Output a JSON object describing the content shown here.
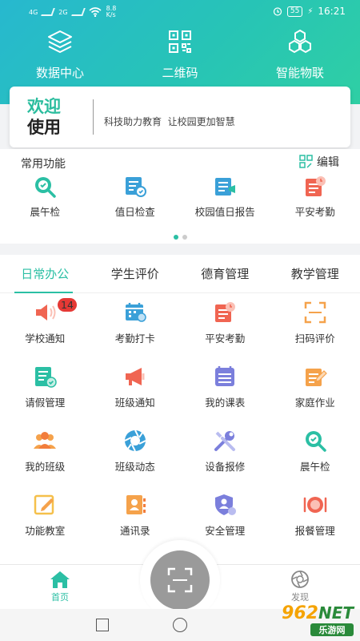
{
  "status_bar": {
    "left_1": "4G",
    "left_2": "2G",
    "speed": "8.8\nK/s",
    "battery": "55",
    "time": "16:21"
  },
  "top_nav": [
    {
      "label": "数据中心",
      "icon": "layers-icon"
    },
    {
      "label": "二维码",
      "icon": "qr-code-icon"
    },
    {
      "label": "智能物联",
      "icon": "iot-hexagon-icon"
    }
  ],
  "welcome": {
    "title_line1": "欢迎",
    "title_line2": "使用",
    "slogan": "科技助力教育  让校园更加智慧"
  },
  "common": {
    "title": "常用功能",
    "edit_label": "编辑",
    "items": [
      {
        "label": "晨午检",
        "icon": "search-check-icon"
      },
      {
        "label": "值日检查",
        "icon": "duty-check-icon"
      },
      {
        "label": "校园值日报告",
        "icon": "duty-report-icon"
      },
      {
        "label": "平安考勤",
        "icon": "attendance-clock-icon"
      }
    ]
  },
  "tabs": [
    {
      "label": "日常办公",
      "active": true
    },
    {
      "label": "学生评价",
      "active": false
    },
    {
      "label": "德育管理",
      "active": false
    },
    {
      "label": "教学管理",
      "active": false
    }
  ],
  "grid": [
    [
      {
        "label": "学校通知",
        "icon": "speaker-icon",
        "badge": "14"
      },
      {
        "label": "考勤打卡",
        "icon": "calendar-icon"
      },
      {
        "label": "平安考勤",
        "icon": "attendance-clock-icon"
      },
      {
        "label": "扫码评价",
        "icon": "scan-frame-icon"
      }
    ],
    [
      {
        "label": "请假管理",
        "icon": "leave-doc-icon"
      },
      {
        "label": "班级通知",
        "icon": "megaphone-icon"
      },
      {
        "label": "我的课表",
        "icon": "timetable-icon"
      },
      {
        "label": "家庭作业",
        "icon": "homework-icon"
      }
    ],
    [
      {
        "label": "我的班级",
        "icon": "class-people-icon"
      },
      {
        "label": "班级动态",
        "icon": "camera-aperture-icon"
      },
      {
        "label": "设备报修",
        "icon": "repair-tools-icon"
      },
      {
        "label": "晨午检",
        "icon": "search-check-icon"
      }
    ],
    [
      {
        "label": "功能教室",
        "icon": "classroom-edit-icon"
      },
      {
        "label": "通讯录",
        "icon": "contacts-icon"
      },
      {
        "label": "安全管理",
        "icon": "shield-user-icon"
      },
      {
        "label": "报餐管理",
        "icon": "meal-icon"
      }
    ]
  ],
  "bottom_nav": {
    "home_label": "首页",
    "discover_label": "发现"
  },
  "watermark": {
    "number": "962",
    "net": "NET",
    "sub": "乐游网"
  },
  "colors": {
    "accent": "#2bbfa4",
    "header_start": "#27b8cf",
    "header_end": "#2fcfa4",
    "badge": "#e53935"
  }
}
